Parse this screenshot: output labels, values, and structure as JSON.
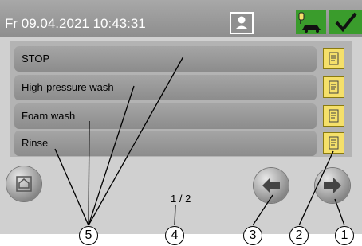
{
  "header": {
    "datetime": "Fr 09.04.2021  10:43:31"
  },
  "programs": [
    {
      "label": "STOP"
    },
    {
      "label": "High-pressure wash"
    },
    {
      "label": "Foam wash"
    },
    {
      "label": "Rinse"
    }
  ],
  "pagination": {
    "indicator": "1 / 2"
  },
  "callouts": [
    "1",
    "2",
    "3",
    "4",
    "5"
  ],
  "colors": {
    "header": "#999999",
    "item": "#9a9a9a",
    "accent_green": "#3a9c2c",
    "side_button": "#f5e06a"
  },
  "icons": [
    "user-icon",
    "car-wash-icon",
    "checkmark-icon",
    "program-settings-icon",
    "home-icon",
    "arrow-left-icon",
    "arrow-right-icon"
  ]
}
